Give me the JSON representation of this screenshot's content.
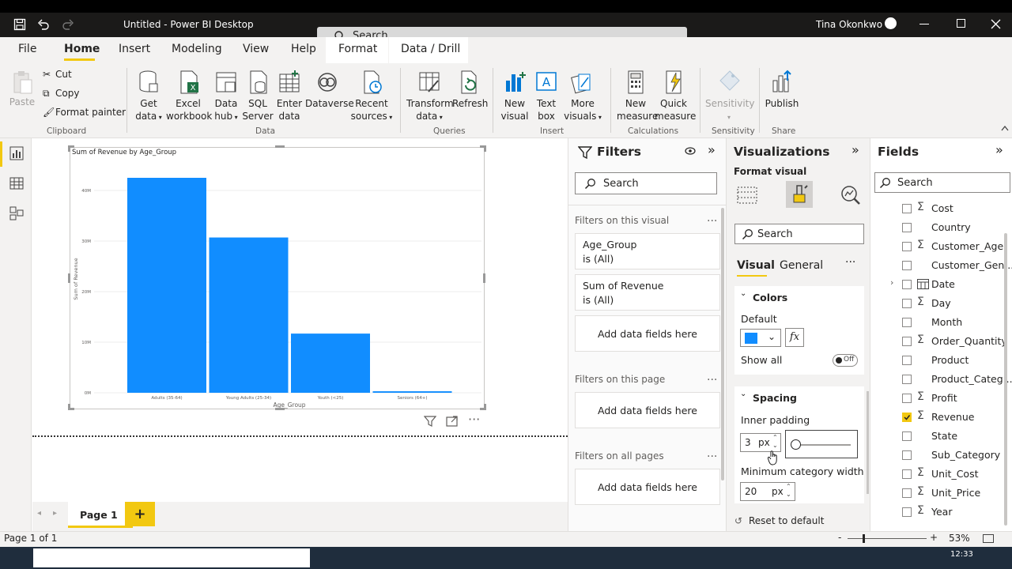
{
  "window": {
    "title": "Untitled - Power BI Desktop",
    "search_placeholder": "Search",
    "user_name": "Tina Okonkwo"
  },
  "menu": {
    "tabs": [
      "File",
      "Home",
      "Insert",
      "Modeling",
      "View",
      "Help",
      "Format",
      "Data / Drill"
    ],
    "active": "Home"
  },
  "ribbon": {
    "clipboard": {
      "paste": "Paste",
      "cut": "Cut",
      "copy": "Copy",
      "format_painter": "Format painter",
      "group": "Clipboard"
    },
    "data": {
      "get_data": [
        "Get",
        "data"
      ],
      "excel": [
        "Excel",
        "workbook"
      ],
      "data_hub": [
        "Data",
        "hub"
      ],
      "sql": [
        "SQL",
        "Server"
      ],
      "enter": [
        "Enter",
        "data"
      ],
      "dataverse": "Dataverse",
      "recent": [
        "Recent",
        "sources"
      ],
      "group": "Data"
    },
    "queries": {
      "transform": [
        "Transform",
        "data"
      ],
      "refresh": "Refresh",
      "group": "Queries"
    },
    "insert": {
      "new_visual": [
        "New",
        "visual"
      ],
      "text_box": [
        "Text",
        "box"
      ],
      "more_visuals": [
        "More",
        "visuals"
      ],
      "group": "Insert"
    },
    "calculations": {
      "new_measure": [
        "New",
        "measure"
      ],
      "quick_measure": [
        "Quick",
        "measure"
      ],
      "group": "Calculations"
    },
    "sensitivity": {
      "label": "Sensitivity",
      "group": "Sensitivity"
    },
    "share": {
      "publish": "Publish",
      "group": "Share"
    }
  },
  "report": {
    "visual_title": "Sum of Revenue by Age_Group",
    "page_tab": "Page 1",
    "add_page": "+"
  },
  "chart_data": {
    "type": "bar",
    "title": "Sum of Revenue by Age_Group",
    "xlabel": "Age_Group",
    "ylabel": "Sum of Revenue",
    "categories": [
      "Adults (35-64)",
      "Young Adults (25-34)",
      "Youth (<25)",
      "Seniors (64+)"
    ],
    "values": [
      42.5,
      30.7,
      11.7,
      0.3
    ],
    "y_ticks": [
      "0M",
      "10M",
      "20M",
      "30M",
      "40M"
    ],
    "ylim": [
      0,
      45
    ],
    "grid": true,
    "bar_color": "#118dff"
  },
  "filters": {
    "title": "Filters",
    "search": "Search",
    "on_visual": "Filters on this visual",
    "cards": [
      {
        "field": "Age_Group",
        "state": "is (All)"
      },
      {
        "field": "Sum of Revenue",
        "state": "is (All)"
      }
    ],
    "add_fields": "Add data fields here",
    "on_page": "Filters on this page",
    "on_all_pages": "Filters on all pages",
    "more": "..."
  },
  "visualizations": {
    "title": "Visualizations",
    "subtitle": "Format visual",
    "search": "Search",
    "tabs": [
      "Visual",
      "General"
    ],
    "colors_section": "Colors",
    "default_label": "Default",
    "default_color": "#118dff",
    "fx": "fx",
    "show_all": "Show all",
    "toggle_state": "Off",
    "spacing_section": "Spacing",
    "inner_padding_label": "Inner padding",
    "inner_padding_value": "3",
    "unit": "px",
    "min_cat_label": "Minimum category width",
    "min_cat_value": "20",
    "reset": "Reset to default"
  },
  "fields": {
    "title": "Fields",
    "search": "Search",
    "items": [
      {
        "name": "Cost",
        "sigma": true,
        "checked": false
      },
      {
        "name": "Country",
        "sigma": false,
        "checked": false
      },
      {
        "name": "Customer_Age",
        "sigma": true,
        "checked": false
      },
      {
        "name": "Customer_Gen...",
        "sigma": false,
        "checked": false
      },
      {
        "name": "Date",
        "sigma": false,
        "checked": false,
        "table": true
      },
      {
        "name": "Day",
        "sigma": true,
        "checked": false
      },
      {
        "name": "Month",
        "sigma": false,
        "checked": false
      },
      {
        "name": "Order_Quantity",
        "sigma": true,
        "checked": false
      },
      {
        "name": "Product",
        "sigma": false,
        "checked": false
      },
      {
        "name": "Product_Categ...",
        "sigma": false,
        "checked": false
      },
      {
        "name": "Profit",
        "sigma": true,
        "checked": false
      },
      {
        "name": "Revenue",
        "sigma": true,
        "checked": true
      },
      {
        "name": "State",
        "sigma": false,
        "checked": false
      },
      {
        "name": "Sub_Category",
        "sigma": false,
        "checked": false
      },
      {
        "name": "Unit_Cost",
        "sigma": true,
        "checked": false
      },
      {
        "name": "Unit_Price",
        "sigma": true,
        "checked": false
      },
      {
        "name": "Year",
        "sigma": true,
        "checked": false
      }
    ]
  },
  "status": {
    "page": "Page 1 of 1",
    "zoom": "53%",
    "minus": "-",
    "plus": "+",
    "clock": "12:33"
  },
  "colors": {
    "accent": "#f2c811",
    "bar": "#118dff"
  }
}
